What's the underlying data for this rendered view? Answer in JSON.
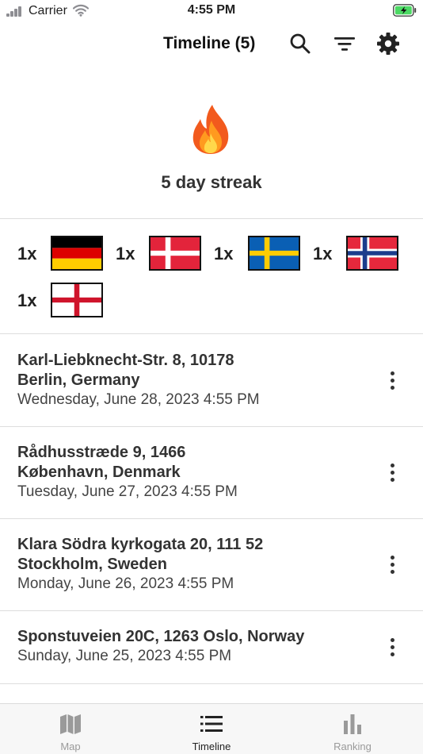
{
  "status_bar": {
    "carrier": "Carrier",
    "time": "4:55 PM",
    "icons": [
      "signal-icon",
      "wifi-icon",
      "battery-charging-icon"
    ]
  },
  "header": {
    "title": "Timeline (5)",
    "icons": [
      "search-icon",
      "filter-icon",
      "gear-icon"
    ]
  },
  "streak": {
    "icon": "fire-icon",
    "text": "5 day streak"
  },
  "flags": [
    {
      "count": "1x",
      "country": "germany",
      "colors": [
        "#000000",
        "#dd0000",
        "#ffcc00"
      ]
    },
    {
      "count": "1x",
      "country": "denmark",
      "colors": [
        "#e3243b",
        "#ffffff"
      ]
    },
    {
      "count": "1x",
      "country": "sweden",
      "colors": [
        "#0a5fb4",
        "#fecc02"
      ]
    },
    {
      "count": "1x",
      "country": "norway",
      "colors": [
        "#e6283c",
        "#ffffff",
        "#1b3d8c"
      ]
    },
    {
      "count": "1x",
      "country": "england",
      "colors": [
        "#ffffff",
        "#cf142b"
      ]
    }
  ],
  "timeline": [
    {
      "line1": "Karl-Liebknecht-Str. 8, 10178",
      "line2": "Berlin, Germany",
      "date": "Wednesday, June 28, 2023 4:55 PM"
    },
    {
      "line1": "Rådhusstræde 9, 1466",
      "line2": "København, Denmark",
      "date": "Tuesday, June 27, 2023 4:55 PM"
    },
    {
      "line1": "Klara Södra kyrkogata 20, 111 52",
      "line2": "Stockholm, Sweden",
      "date": "Monday, June 26, 2023 4:55 PM"
    },
    {
      "line1": "Sponstuveien 20C, 1263 Oslo, Norway",
      "date": "Sunday, June 25, 2023 4:55 PM"
    }
  ],
  "tabs": [
    {
      "label": "Map",
      "icon": "map-icon",
      "active": false
    },
    {
      "label": "Timeline",
      "icon": "list-icon",
      "active": true
    },
    {
      "label": "Ranking",
      "icon": "bar-chart-icon",
      "active": false
    }
  ],
  "colors": {
    "text_primary": "#222222",
    "tab_inactive": "#9a9a9a",
    "divider": "#dddddd"
  }
}
